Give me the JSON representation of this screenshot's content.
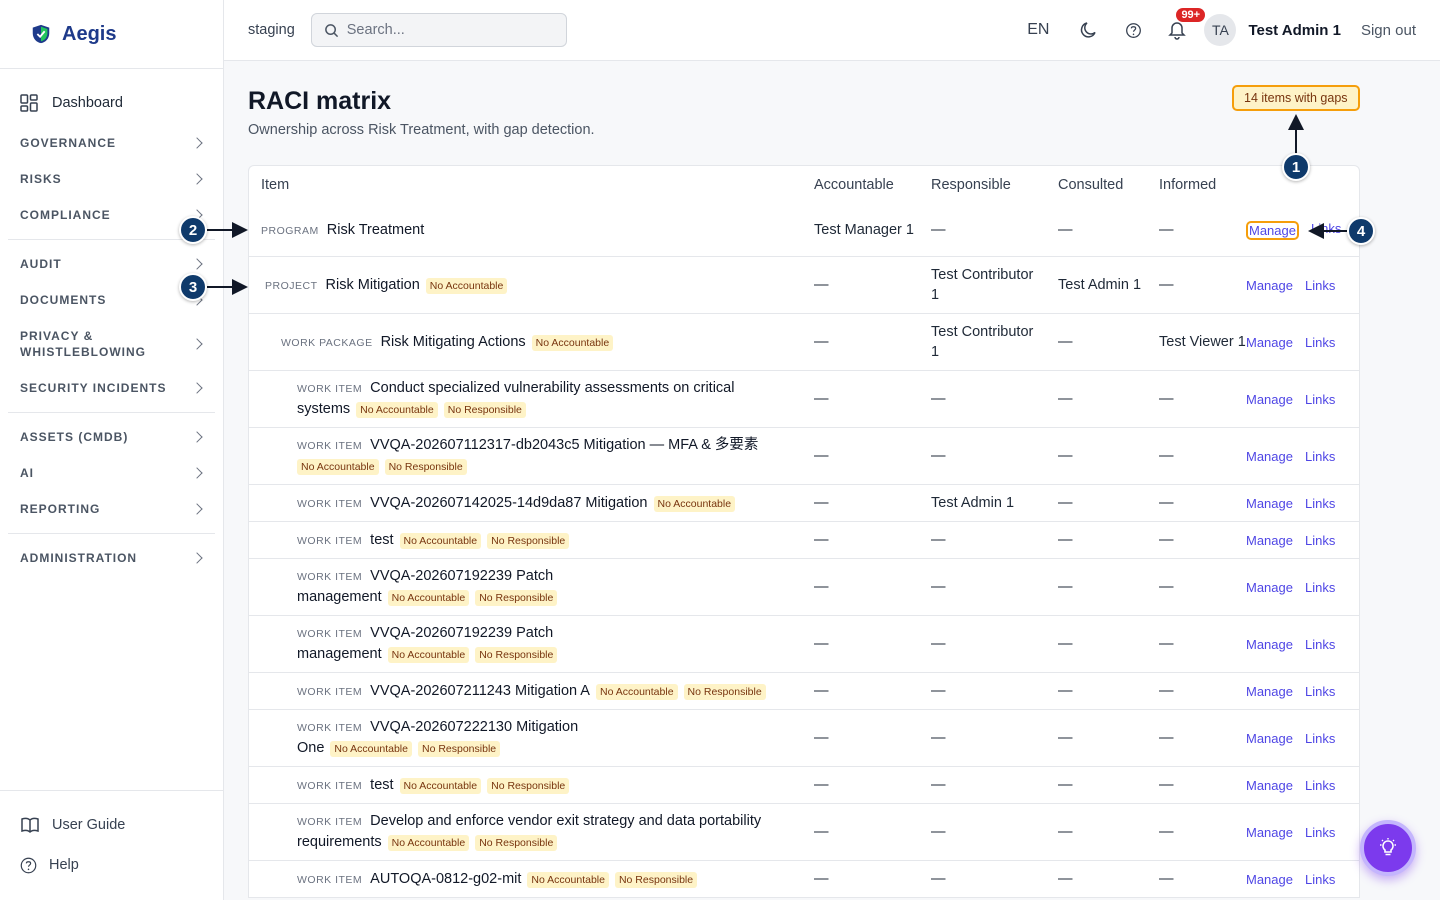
{
  "brand": {
    "name": "Aegis"
  },
  "sidebar": {
    "dashboard": "Dashboard",
    "groups": [
      [
        "GOVERNANCE",
        "RISKS",
        "COMPLIANCE"
      ],
      [
        "AUDIT",
        "DOCUMENTS",
        "PRIVACY & WHISTLEBLOWING",
        "SECURITY INCIDENTS"
      ],
      [
        "ASSETS (CMDB)",
        "AI",
        "REPORTING"
      ],
      [
        "ADMINISTRATION"
      ]
    ],
    "user_guide": "User Guide",
    "help": "Help"
  },
  "topbar": {
    "env": "staging",
    "search_placeholder": "Search...",
    "lang": "EN",
    "notif_count": "99+",
    "avatar": "TA",
    "user_name": "Test Admin 1",
    "sign_out": "Sign out"
  },
  "page": {
    "title": "RACI matrix",
    "subtitle": "Ownership across Risk Treatment, with gap detection.",
    "gaps_badge": "14 items with gaps"
  },
  "table": {
    "columns": [
      "Item",
      "Accountable",
      "Responsible",
      "Consulted",
      "Informed"
    ],
    "actions": {
      "manage": "Manage",
      "links": "Links"
    },
    "rows": [
      {
        "type": "PROGRAM",
        "indent": 0,
        "name": "Risk Treatment",
        "tags": [],
        "a": "Test Manager 1",
        "r": "—",
        "c": "—",
        "i": "—",
        "h": 52
      },
      {
        "type": "PROJECT",
        "indent": 1,
        "name": "Risk Mitigation",
        "tags": [
          "No Accountable"
        ],
        "a": "—",
        "r": "Test Contributor 1",
        "c": "Test Admin 1",
        "i": "—",
        "h": 57
      },
      {
        "type": "WORK PACKAGE",
        "indent": 2,
        "name": "Risk Mitigating Actions",
        "tags": [
          "No Accountable"
        ],
        "a": "—",
        "r": "Test Contributor 1",
        "c": "—",
        "i": "Test Viewer 1",
        "h": 57
      },
      {
        "type": "WORK ITEM",
        "indent": 3,
        "name": "Conduct specialized vulnerability assessments on critical systems",
        "tags": [
          "No Accountable",
          "No Responsible"
        ],
        "a": "—",
        "r": "—",
        "c": "—",
        "i": "—",
        "h": 57
      },
      {
        "type": "WORK ITEM",
        "indent": 3,
        "name": "VVQA-202607112317-db2043c5 Mitigation — MFA & 多要素",
        "tags": [
          "No Accountable",
          "No Responsible"
        ],
        "a": "—",
        "r": "—",
        "c": "—",
        "i": "—",
        "h": 57
      },
      {
        "type": "WORK ITEM",
        "indent": 3,
        "name": "VVQA-202607142025-14d9da87 Mitigation",
        "tags": [
          "No Accountable"
        ],
        "a": "—",
        "r": "Test Admin 1",
        "c": "—",
        "i": "—",
        "h": 37
      },
      {
        "type": "WORK ITEM",
        "indent": 3,
        "name": "test",
        "tags": [
          "No Accountable",
          "No Responsible"
        ],
        "a": "—",
        "r": "—",
        "c": "—",
        "i": "—",
        "h": 37
      },
      {
        "type": "WORK ITEM",
        "indent": 3,
        "name": "VVQA-202607192239 Patch management",
        "tags": [
          "No Accountable",
          "No Responsible"
        ],
        "a": "—",
        "r": "—",
        "c": "—",
        "i": "—",
        "h": 57
      },
      {
        "type": "WORK ITEM",
        "indent": 3,
        "name": "VVQA-202607192239 Patch management",
        "tags": [
          "No Accountable",
          "No Responsible"
        ],
        "a": "—",
        "r": "—",
        "c": "—",
        "i": "—",
        "h": 57
      },
      {
        "type": "WORK ITEM",
        "indent": 3,
        "name": "VVQA-202607211243 Mitigation A",
        "tags": [
          "No Accountable",
          "No Responsible"
        ],
        "a": "—",
        "r": "—",
        "c": "—",
        "i": "—",
        "h": 37
      },
      {
        "type": "WORK ITEM",
        "indent": 3,
        "name": "VVQA-202607222130 Mitigation One",
        "tags": [
          "No Accountable",
          "No Responsible"
        ],
        "a": "—",
        "r": "—",
        "c": "—",
        "i": "—",
        "h": 57
      },
      {
        "type": "WORK ITEM",
        "indent": 3,
        "name": "test",
        "tags": [
          "No Accountable",
          "No Responsible"
        ],
        "a": "—",
        "r": "—",
        "c": "—",
        "i": "—",
        "h": 37
      },
      {
        "type": "WORK ITEM",
        "indent": 3,
        "name": "Develop and enforce vendor exit strategy and data portability requirements",
        "tags": [
          "No Accountable",
          "No Responsible"
        ],
        "a": "—",
        "r": "—",
        "c": "—",
        "i": "—",
        "h": 57
      },
      {
        "type": "WORK ITEM",
        "indent": 3,
        "name": "AUTOQA-0812-g02-mit",
        "tags": [
          "No Accountable",
          "No Responsible"
        ],
        "a": "—",
        "r": "—",
        "c": "—",
        "i": "—",
        "h": 37
      }
    ]
  },
  "callouts": [
    "1",
    "2",
    "3",
    "4"
  ],
  "colors": {
    "accent": "#4f46e5",
    "brand": "#1e3a8a",
    "tag_bg": "#fef3c7",
    "highlight": "#f59e0b",
    "callout": "#0f3a6b",
    "fab": "#7c3aed"
  }
}
